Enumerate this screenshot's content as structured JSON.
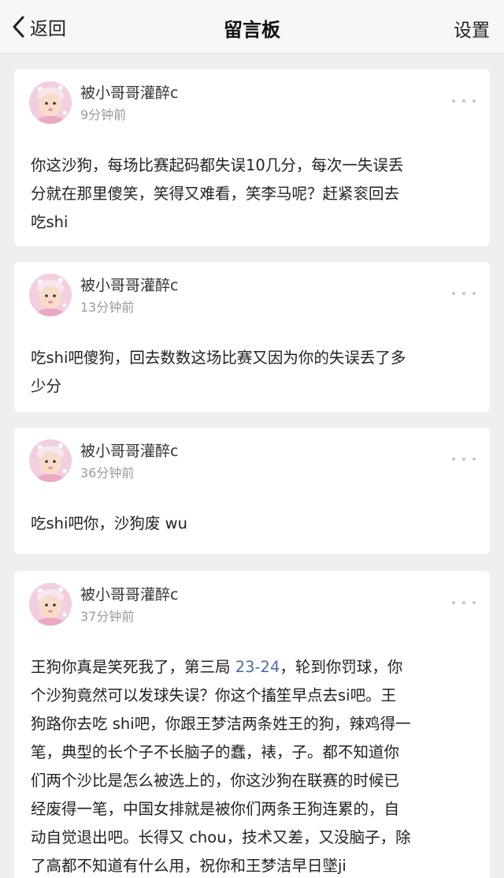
{
  "nav": {
    "back_label": "返回",
    "title": "留言板",
    "settings_label": "设置"
  },
  "comments": [
    {
      "username": "被小哥哥灌醉c",
      "time": "9分钟前",
      "lines": [
        "你这沙狗，每场比赛起码都失误10几分，每次一失误丢",
        "分就在那里傻笑，笑得又难看，笑李马呢？赶紧衮回去",
        "吃shi"
      ]
    },
    {
      "username": "被小哥哥灌醉c",
      "time": "13分钟前",
      "lines": [
        "吃shi吧傻狗，回去数数这场比赛又因为你的失误丢了多",
        "少分"
      ]
    },
    {
      "username": "被小哥哥灌醉c",
      "time": "36分钟前",
      "lines": [
        "吃shi吧你，沙狗废 wu"
      ]
    },
    {
      "username": "被小哥哥灌醉c",
      "time": "37分钟前",
      "line1_before": "王狗你真是笑死我了，第三局 ",
      "line1_link": "23-24",
      "line1_after": "，轮到你罚球，你",
      "lines": [
        "个沙狗竟然可以发球失误？你这个搐笙早点去si吧。王",
        "狗路你去吃 shi吧，你跟王梦洁两条姓王的狗，辣鸡得一",
        "笔，典型的长个子不长脑子的蠢，裱，子。都不知道你",
        "们两个沙比是怎么被选上的，你这沙狗在联赛的时候已",
        "经废得一笔，中国女排就是被你们两条王狗连累的，自",
        "动自觉退出吧。长得又 chou，技术又差，又没脑子，除",
        "了高都不知道有什么用，祝你和王梦洁早日墜ji"
      ]
    }
  ]
}
